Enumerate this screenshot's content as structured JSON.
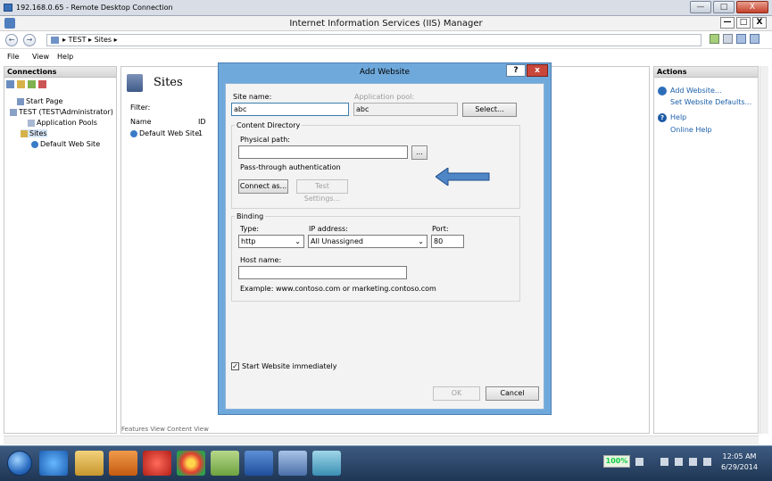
{
  "rdp": {
    "title": "192.168.0.65 - Remote Desktop Connection",
    "buttons": [
      "—",
      "□",
      "X"
    ]
  },
  "window": {
    "title": "Internet Information Services (IIS) Manager",
    "buttons": [
      "—",
      "□",
      "X"
    ]
  },
  "address": {
    "back": "←",
    "forward": "→",
    "path": "▸  TEST  ▸  Sites  ▸"
  },
  "menu": [
    "File",
    "View",
    "Help"
  ],
  "connections": {
    "header": "Connections",
    "tree": [
      "Start Page",
      "TEST (TEST\\Administrator)",
      "Application Pools",
      "Sites",
      "Default Web Site"
    ]
  },
  "main": {
    "title": "Sites",
    "filter_label": "Filter:",
    "columns": [
      "Name",
      "ID"
    ],
    "rows": [
      {
        "name": "Default Web Site",
        "id": "1"
      }
    ],
    "tabs": "Features View   Content View"
  },
  "actions": {
    "header": "Actions",
    "links": [
      "Add Website...",
      "Set Website Defaults...",
      "Help",
      "Online Help"
    ]
  },
  "dialog": {
    "title": "Add Website",
    "help": "?",
    "close": "x",
    "site_name_label": "Site name:",
    "site_name_value": "abc",
    "app_pool_label": "Application pool:",
    "app_pool_value": "abc",
    "select_button": "Select...",
    "content_dir_label": "Content Directory",
    "physical_path_label": "Physical path:",
    "physical_path_value": "",
    "browse_button": "...",
    "passthrough_label": "Pass-through authentication",
    "connect_button": "Connect as...",
    "test_button": "Test Settings...",
    "binding_label": "Binding",
    "type_label": "Type:",
    "type_value": "http",
    "ip_label": "IP address:",
    "ip_value": "All Unassigned",
    "port_label": "Port:",
    "port_value": "80",
    "hostname_label": "Host name:",
    "hostname_value": "",
    "example_text": "Example: www.contoso.com or marketing.contoso.com",
    "start_label": "Start Website immediately",
    "ok_button": "OK",
    "cancel_button": "Cancel"
  },
  "taskbar": {
    "battery": "100%",
    "time": "12:05 AM",
    "date": "6/29/2014"
  },
  "colors": {
    "dialog_frame": "#6fa9db",
    "arrow": "#4f86c6",
    "taskbar": "#2a4568"
  }
}
